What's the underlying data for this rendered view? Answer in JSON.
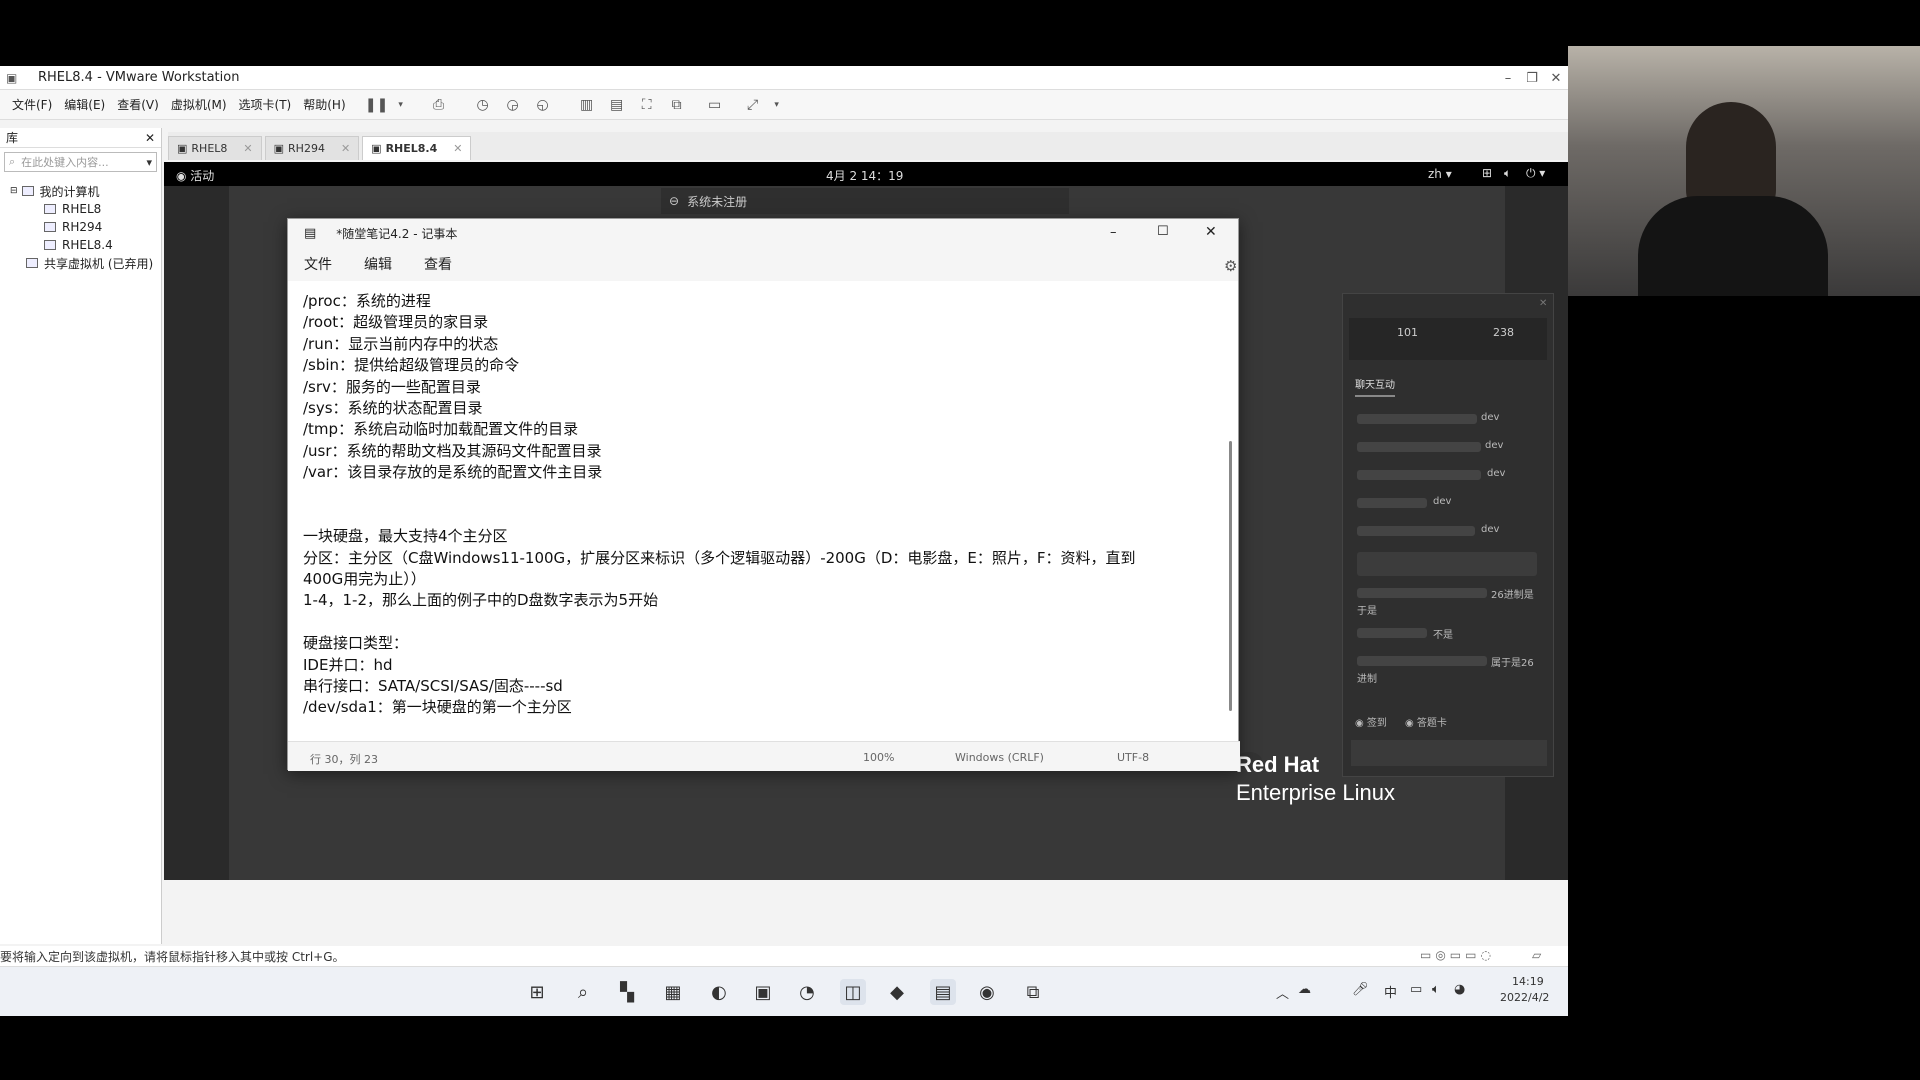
{
  "window": {
    "title": "RHEL8.4 - VMware Workstation"
  },
  "menu": [
    "文件(F)",
    "编辑(E)",
    "查看(V)",
    "虚拟机(M)",
    "选项卡(T)",
    "帮助(H)"
  ],
  "library": {
    "header": "库",
    "close": "✕",
    "search_placeholder": "在此处键入内容...",
    "tree": [
      {
        "label": "我的计算机",
        "level": 0
      },
      {
        "label": "RHEL8",
        "level": 1
      },
      {
        "label": "RH294",
        "level": 1
      },
      {
        "label": "RHEL8.4",
        "level": 1
      },
      {
        "label": "共享虚拟机 (已弃用)",
        "level": 0
      }
    ]
  },
  "tabs": [
    {
      "label": "RHEL8",
      "active": false
    },
    {
      "label": "RH294",
      "active": false
    },
    {
      "label": "RHEL8.4",
      "active": true
    }
  ],
  "gnome": {
    "activities": "活动",
    "clock": "4月 2  14：19",
    "lang": "zh",
    "notice": "系统未注册"
  },
  "notepad": {
    "title": "*随堂笔记4.2 - 记事本",
    "menu": [
      "文件",
      "编辑",
      "查看"
    ],
    "lines": [
      "/proc：系统的进程",
      "/root：超级管理员的家目录",
      "/run：显示当前内存中的状态",
      "/sbin：提供给超级管理员的命令",
      "/srv：服务的一些配置目录",
      "/sys：系统的状态配置目录",
      "/tmp：系统启动临时加载配置文件的目录",
      "/usr：系统的帮助文档及其源码文件配置目录",
      "/var：该目录存放的是系统的配置文件主目录",
      "",
      "",
      "一块硬盘，最大支持4个主分区",
      "分区：主分区（C盘Windows11-100G，扩展分区来标识（多个逻辑驱动器）-200G（D：电影盘，E：照片，F：资料，直到",
      "400G用完为止））",
      "1-4，1-2，那么上面的例子中的D盘数字表示为5开始",
      "",
      "硬盘接口类型：",
      "IDE并口：hd",
      "串行接口：SATA/SCSI/SAS/固态----sd",
      "/dev/sda1：第一块硬盘的第一个主分区"
    ],
    "status": {
      "position": "行 30，列 23",
      "zoom": "100%",
      "eol": "Windows (CRLF)",
      "encoding": "UTF-8"
    }
  },
  "brand": {
    "line1": "Red Hat",
    "line2": "Enterprise Linux"
  },
  "chat": {
    "stat1": "101",
    "stat2": "238",
    "tab_active": "聊天互动",
    "messages": [
      "dev",
      "dev",
      "dev",
      "dev",
      "dev",
      "26进制是",
      "于是",
      "不是",
      "属于是26",
      "进制"
    ],
    "footer_left": "签到",
    "footer_right": "答题卡"
  },
  "statusbar": {
    "text": "要将输入定向到该虚拟机，请将鼠标指针移入其中或按 Ctrl+G。"
  },
  "taskbar": {
    "ime": "中",
    "time": "14:19",
    "date": "2022/4/2"
  },
  "colors": {
    "desktop": "#383838",
    "gnome_bar": "#000000",
    "notepad_bg": "#ffffff"
  }
}
